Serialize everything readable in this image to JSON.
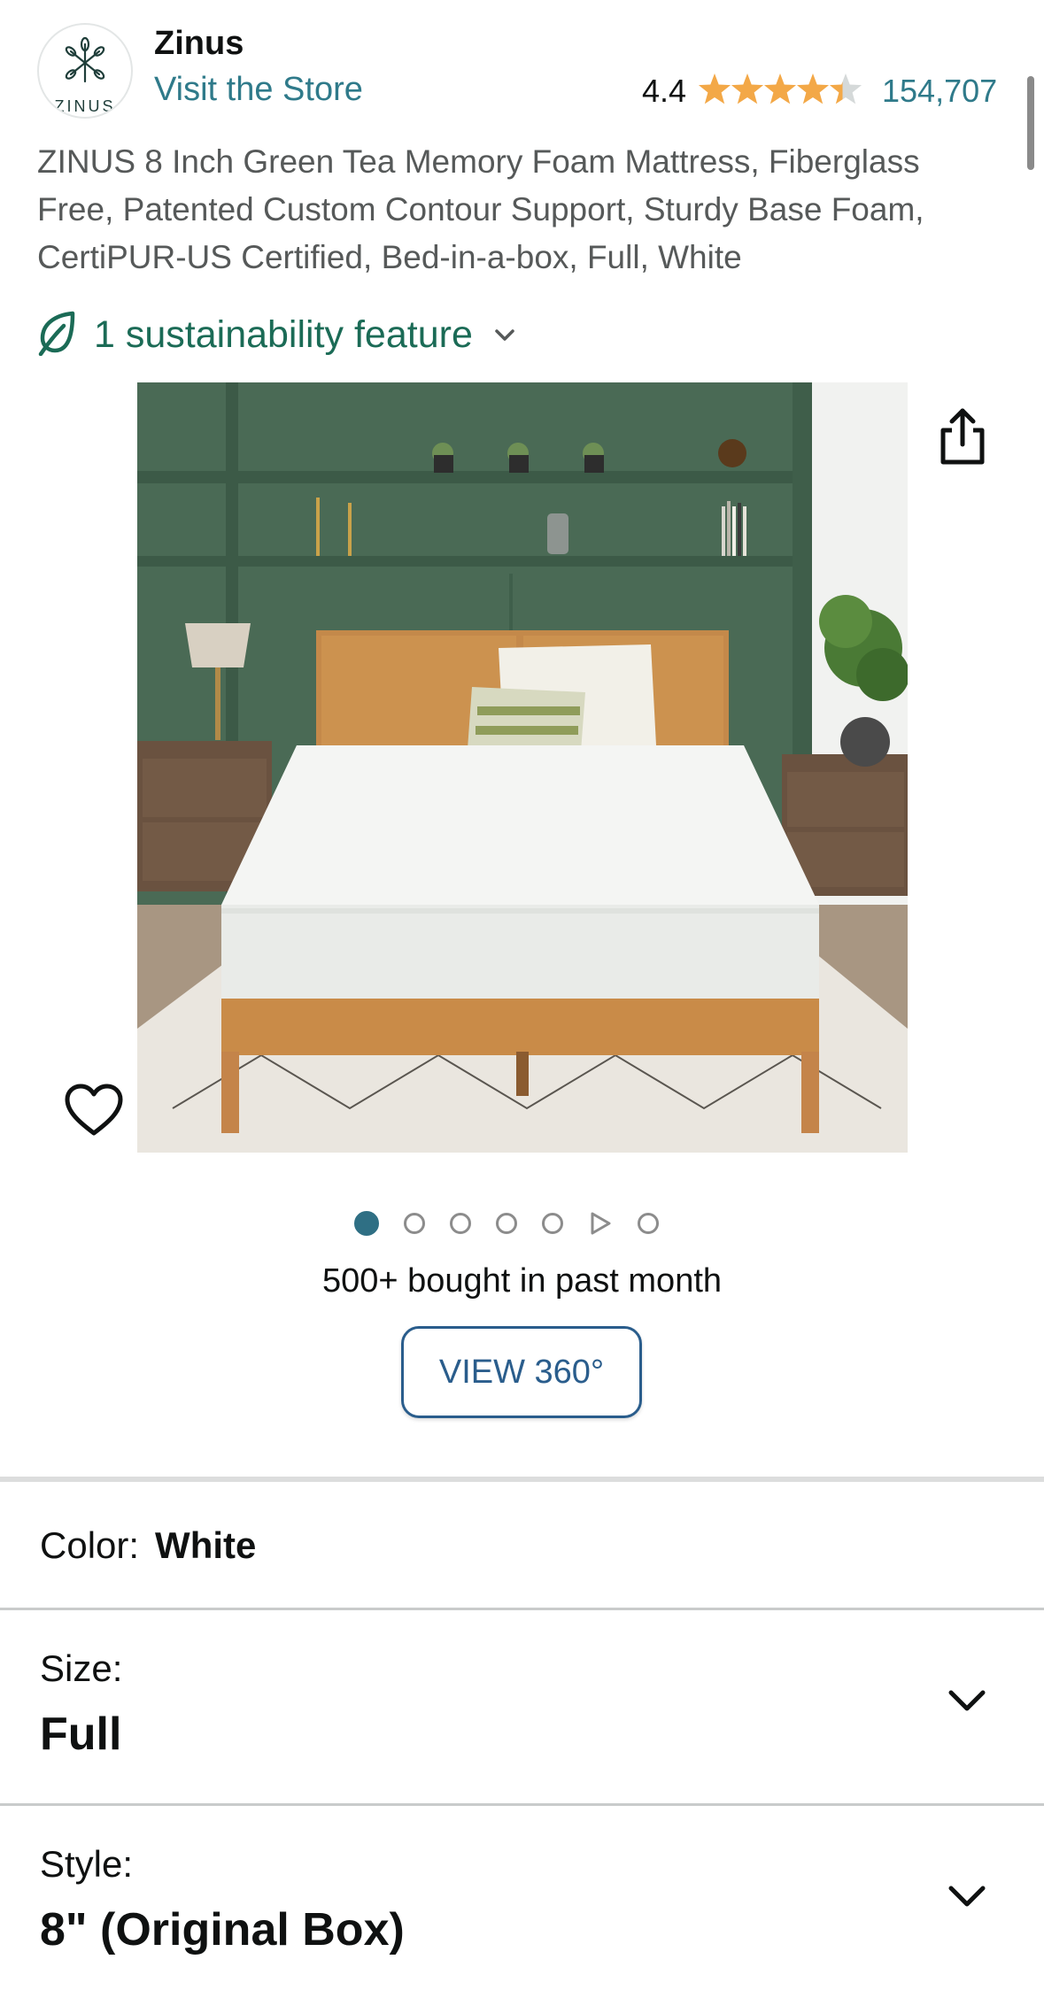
{
  "brand": {
    "name": "Zinus",
    "logo_text": "ZINUS",
    "visit_store": "Visit the Store"
  },
  "rating": {
    "value": "4.4",
    "stars": 4.4,
    "count": "154,707"
  },
  "product": {
    "title": "ZINUS 8 Inch Green Tea Memory Foam Mattress, Fiberglass Free, Patented Custom Contour Support, Sturdy Base Foam, CertiPUR-US Certified, Bed-in-a-box, Full, White"
  },
  "sustainability": {
    "label": "1 sustainability feature"
  },
  "gallery": {
    "image_count": 7,
    "active_index": 0,
    "video_index": 5
  },
  "social_proof": "500+ bought in past month",
  "view360_label": "VIEW 360°",
  "options": {
    "color": {
      "label": "Color:",
      "value": "White"
    },
    "size": {
      "label": "Size:",
      "value": "Full"
    },
    "style": {
      "label": "Style:",
      "value": "8\" (Original Box)"
    }
  },
  "colors": {
    "link": "#2f7a8a",
    "star": "#f3a847",
    "sustain": "#1b6b56",
    "button_blue": "#2a5d8c",
    "dot_active": "#2f6f84"
  }
}
